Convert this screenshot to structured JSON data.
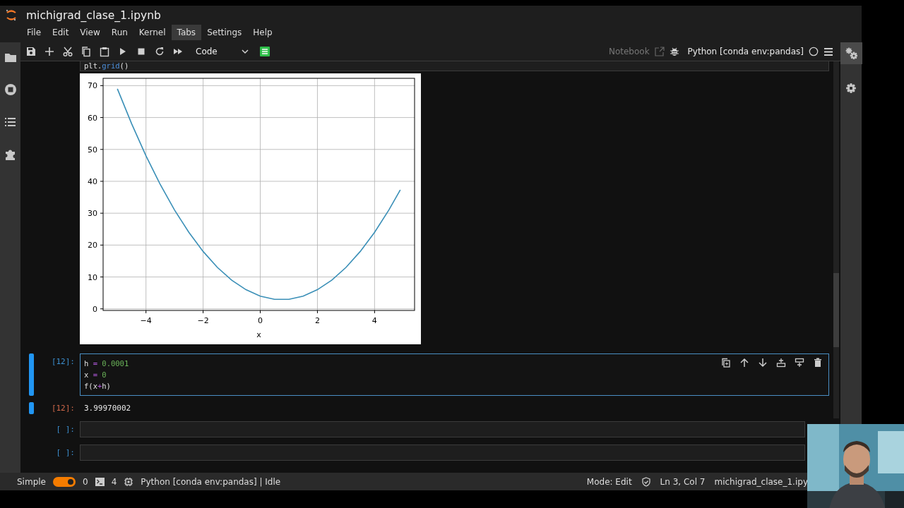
{
  "window": {
    "title": "michigrad_clase_1.ipynb"
  },
  "menu": [
    {
      "label": "File",
      "selected": false
    },
    {
      "label": "Edit",
      "selected": false
    },
    {
      "label": "View",
      "selected": false
    },
    {
      "label": "Run",
      "selected": false
    },
    {
      "label": "Kernel",
      "selected": false
    },
    {
      "label": "Tabs",
      "selected": true
    },
    {
      "label": "Settings",
      "selected": false
    },
    {
      "label": "Help",
      "selected": false
    }
  ],
  "toolbar": {
    "cell_type": "Code",
    "notebook_link": "Notebook",
    "kernel": "Python [conda env:pandas]",
    "kernel_busy": false
  },
  "cells": [
    {
      "kind": "code_tail",
      "lines": [
        [
          {
            "kind": "name",
            "text": "plt."
          },
          {
            "kind": "attr",
            "text": "grid"
          },
          {
            "kind": "name",
            "text": "()"
          }
        ]
      ]
    },
    {
      "kind": "plot",
      "chart_data": {
        "type": "line",
        "xlabel": "x",
        "x": [
          -5,
          -4.5,
          -4,
          -3.5,
          -3,
          -2.5,
          -2,
          -1.5,
          -1,
          -0.5,
          0,
          0.5,
          1,
          1.5,
          2,
          2.5,
          3,
          3.5,
          4,
          4.5,
          4.9
        ],
        "grid": true,
        "series": [
          {
            "color": "#3a8fb7",
            "values": [
              69,
              58,
              48,
              39,
              31,
              24,
              18,
              13,
              9,
              6,
              4,
              3,
              3,
              4,
              6,
              9,
              13,
              18,
              24,
              31,
              37.3
            ]
          }
        ],
        "xlim": [
          -5.5,
          5.4
        ],
        "ylim": [
          -0.5,
          72.3
        ],
        "xticks": [
          {
            "value": -4,
            "label": "−4"
          },
          {
            "value": -2,
            "label": "−2"
          },
          0,
          2,
          4
        ],
        "yticks": [
          0,
          10,
          20,
          30,
          40,
          50,
          60,
          70
        ]
      }
    },
    {
      "kind": "code",
      "prompt": "[12]:",
      "active": true,
      "lines": [
        [
          {
            "kind": "name",
            "text": "h "
          },
          {
            "kind": "op",
            "text": "="
          },
          {
            "kind": "number",
            "text": " 0.0001"
          }
        ],
        [
          {
            "kind": "name",
            "text": "x "
          },
          {
            "kind": "op",
            "text": "="
          },
          {
            "kind": "number",
            "text": " 0"
          }
        ],
        [
          {
            "kind": "name",
            "text": "f(x"
          },
          {
            "kind": "op",
            "text": "+"
          },
          {
            "kind": "name",
            "text": "h)"
          }
        ]
      ]
    },
    {
      "kind": "output",
      "prompt": "[12]:",
      "active": true,
      "text": "3.99970002"
    },
    {
      "kind": "code",
      "prompt": "[ ]:",
      "active": false
    },
    {
      "kind": "code",
      "prompt": "[ ]:",
      "active": false
    }
  ],
  "status_bar": {
    "mode_toggle": {
      "label": "Simple",
      "on": true
    },
    "terminals": "0",
    "kernels": "4",
    "kernel_status": "Python [conda env:pandas] | Idle",
    "mode": "Mode: Edit",
    "position": "Ln 3, Col 7",
    "file": "michigrad_clase_1.ipy"
  }
}
